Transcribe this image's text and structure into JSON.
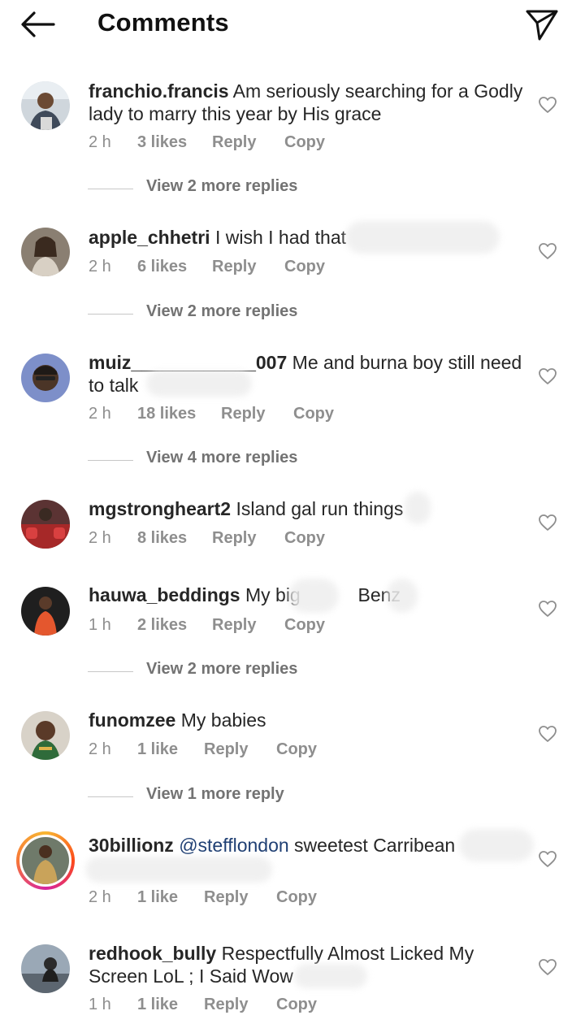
{
  "header": {
    "title": "Comments",
    "back_icon": "arrow-left-icon",
    "share_icon": "paper-plane-icon"
  },
  "comments": [
    {
      "username": "franchio.francis",
      "text": "Am seriously searching for a Godly lady to marry this year by His grace",
      "time": "2 h",
      "likes": "3 likes",
      "reply": "Reply",
      "copy": "Copy",
      "view_replies": "View 2 more replies"
    },
    {
      "username": "apple_chhetri",
      "text": "I wish I had that",
      "time": "2 h",
      "likes": "6 likes",
      "reply": "Reply",
      "copy": "Copy",
      "view_replies": "View 2 more replies"
    },
    {
      "username": "muiz____________007",
      "text": "Me and burna boy still need to talk",
      "time": "2 h",
      "likes": "18 likes",
      "reply": "Reply",
      "copy": "Copy",
      "view_replies": "View 4 more replies"
    },
    {
      "username": "mgstrongheart2",
      "text": "Island gal run things",
      "time": "2 h",
      "likes": "8 likes",
      "reply": "Reply",
      "copy": "Copy"
    },
    {
      "username": "hauwa_beddings",
      "text": "My big",
      "text_tail": "Benz",
      "time": "1 h",
      "likes": "2 likes",
      "reply": "Reply",
      "copy": "Copy",
      "view_replies": "View 2 more replies"
    },
    {
      "username": "funomzee",
      "text": "My babies",
      "time": "2 h",
      "likes": "1 like",
      "reply": "Reply",
      "copy": "Copy",
      "view_replies": "View 1 more reply"
    },
    {
      "username": "30billionz",
      "mention": "@stefflondon",
      "text": "sweetest Carribean",
      "time": "2 h",
      "likes": "1 like",
      "reply": "Reply",
      "copy": "Copy"
    },
    {
      "username": "redhook_bully",
      "text": "Respectfully Almost Licked My Screen LoL ; I Said Wow",
      "time": "1 h",
      "likes": "1 like",
      "reply": "Reply",
      "copy": "Copy"
    }
  ],
  "icons": {
    "like": "heart-outline-icon"
  },
  "colors": {
    "text": "#262626",
    "muted": "#8e8e8e",
    "mention": "#1f3f73",
    "story_ring": "#d6249f"
  }
}
